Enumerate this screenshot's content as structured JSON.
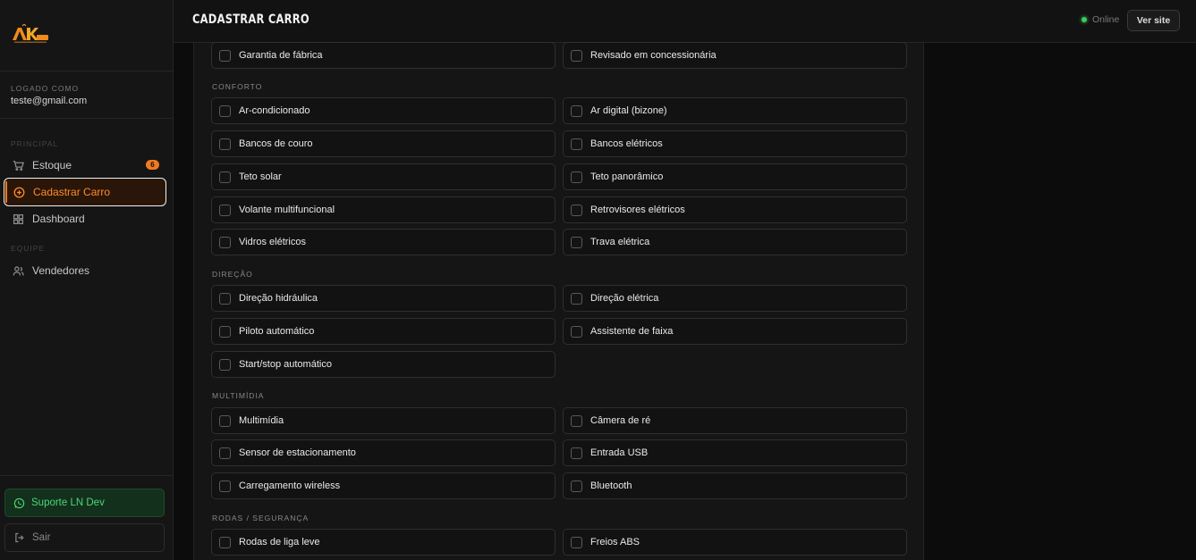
{
  "sidebar": {
    "logo_text": "AKar",
    "logged_label": "LOGADO COMO",
    "email": "teste@gmail.com",
    "section_principal": "PRINCIPAL",
    "section_equipe": "EQUIPE",
    "items": [
      {
        "label": "Estoque",
        "icon": "cart-icon",
        "badge": "6"
      },
      {
        "label": "Cadastrar Carro",
        "icon": "plus-circle-icon"
      },
      {
        "label": "Dashboard",
        "icon": "grid-icon"
      },
      {
        "label": "Vendedores",
        "icon": "users-icon"
      }
    ],
    "support_label": "Suporte LN Dev",
    "logout_label": "Sair"
  },
  "topbar": {
    "title": "CADASTRAR CARRO",
    "status": "Online",
    "ver_site": "Ver site"
  },
  "colors": {
    "accent": "#ff7a1a",
    "online": "#3ccb5e",
    "support": "#4cd775"
  },
  "form": {
    "top_row": [
      "Garantia de fábrica",
      "Revisado em concessionária"
    ],
    "conforto": {
      "label": "CONFORTO",
      "options": [
        "Ar-condicionado",
        "Ar digital (bizone)",
        "Bancos de couro",
        "Bancos elétricos",
        "Teto solar",
        "Teto panorâmico",
        "Volante multifuncional",
        "Retrovisores elétricos",
        "Vidros elétricos",
        "Trava elétrica"
      ]
    },
    "direcao": {
      "label": "DIREÇÃO",
      "options": [
        "Direção hidráulica",
        "Direção elétrica",
        "Piloto automático",
        "Assistente de faixa",
        "Start/stop automático"
      ]
    },
    "multimidia": {
      "label": "MULTIMÍDIA",
      "options": [
        "Multimídia",
        "Câmera de ré",
        "Sensor de estacionamento",
        "Entrada USB",
        "Carregamento wireless",
        "Bluetooth"
      ]
    },
    "rodas": {
      "label": "RODAS / SEGURANÇA",
      "options": [
        "Rodas de liga leve",
        "Freios ABS"
      ]
    }
  }
}
